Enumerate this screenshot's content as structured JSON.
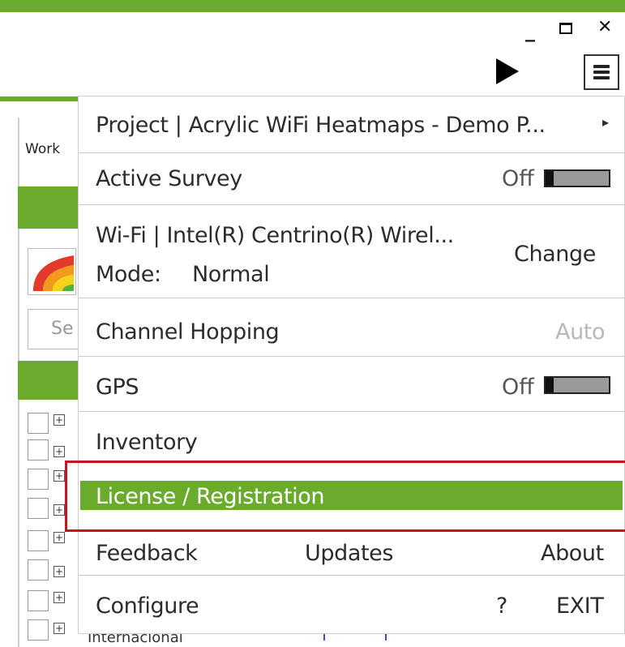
{
  "colors": {
    "accent": "#6aab2d",
    "highlight": "#c8141e"
  },
  "window": {
    "minimize_icon": "minimize-icon",
    "maximize_icon": "maximize-icon",
    "close_icon": "close-icon",
    "play_icon": "play-icon",
    "menu_icon": "hamburger-menu-icon"
  },
  "background": {
    "work_label": "Work",
    "search_placeholder": "Se",
    "row_text": "Internacional"
  },
  "menu": {
    "project_label": "Project  |  Acrylic WiFi Heatmaps - Demo P...",
    "project_arrow": "▸",
    "active_survey_label": "Active Survey",
    "active_survey_state": "Off",
    "wifi_label": "Wi-Fi | Intel(R) Centrino(R) Wirel...",
    "mode_label": "Mode:",
    "mode_value": "Normal",
    "wifi_change": "Change",
    "channel_hopping_label": "Channel Hopping",
    "channel_hopping_value": "Auto",
    "gps_label": "GPS",
    "gps_state": "Off",
    "inventory_label": "Inventory",
    "license_label": "License / Registration",
    "feedback_label": "Feedback",
    "updates_label": "Updates",
    "about_label": "About",
    "configure_label": "Configure",
    "help_label": "?",
    "exit_label": "EXIT"
  }
}
